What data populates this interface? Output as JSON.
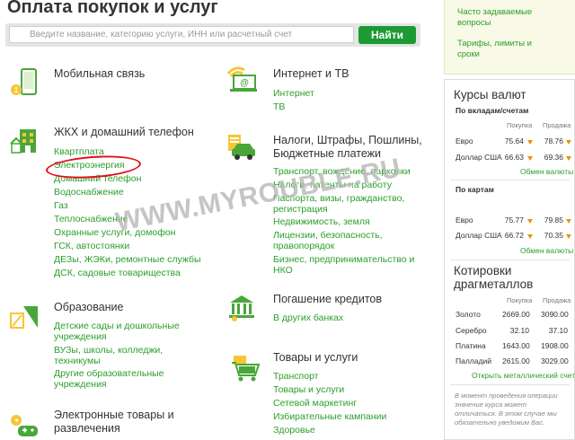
{
  "page": {
    "title": "Оплата покупок и услуг"
  },
  "search": {
    "placeholder": "Введите название, категорию услуги, ИНН или расчетный счет",
    "button_label": "Найти"
  },
  "categories": {
    "mobile": {
      "title": "Мобильная связь"
    },
    "internet": {
      "title": "Интернет и ТВ",
      "links": [
        "Интернет",
        "ТВ"
      ]
    },
    "zhkh": {
      "title": "ЖКХ и домашний телефон",
      "links": [
        "Квартплата",
        "Электроэнергия",
        "Домашний телефон",
        "Водоснабжение",
        "Газ",
        "Теплоснабжение",
        "Охранные услуги, домофон",
        "ГСК, автостоянки",
        "ДЕЗы, ЖЭКи, ремонтные службы",
        "ДСК, садовые товарищества"
      ]
    },
    "taxes": {
      "title_line1": "Налоги, Штрафы, Пошлины,",
      "title_line2": "Бюджетные платежи",
      "links": [
        "Транспорт, вождение, парковки",
        "Налоги, патенты на работу",
        "Паспорта, визы, гражданство,",
        "регистрация",
        "Недвижимость, земля",
        "Лицензии, безопасность,",
        "правопорядок",
        "Бизнес, предпринимательство и",
        "НКО"
      ]
    },
    "education": {
      "title": "Образование",
      "links": [
        "Детские сады и дошкольные",
        "учреждения",
        "ВУЗы, школы, колледжи,",
        "техникумы",
        "Другие образовательные",
        "учреждения"
      ]
    },
    "loans": {
      "title": "Погашение кредитов",
      "links": [
        "В других банках"
      ]
    },
    "goods": {
      "title": "Товары и услуги",
      "links": [
        "Транспорт",
        "Товары и услуги",
        "Сетевой маркетинг",
        "Избирательные кампании",
        "Здоровье"
      ]
    },
    "electronic": {
      "title_line1": "Электронные товары и",
      "title_line2": "развлечения"
    }
  },
  "sidebar": {
    "faq_line1": "Часто задаваемые",
    "faq_line2": "вопросы",
    "tariffs_line1": "Тарифы, лимиты и",
    "tariffs_line2": "сроки"
  },
  "rates": {
    "title": "Курсы валют",
    "deposits": {
      "subtitle": "По вкладам/счетам",
      "buy_label": "Покупка",
      "sell_label": "Продажа",
      "rows": [
        {
          "currency": "Евро",
          "buy": "75.64",
          "sell": "78.76"
        },
        {
          "currency": "Доллар США",
          "buy": "66.63",
          "sell": "69.36"
        }
      ],
      "exchange_link": "Обмен валюты"
    },
    "cards": {
      "subtitle": "По картам",
      "rows": [
        {
          "currency": "Евро",
          "buy": "75.77",
          "sell": "79.85"
        },
        {
          "currency": "Доллар США",
          "buy": "66.72",
          "sell": "70.35"
        }
      ],
      "exchange_link": "Обмен валюты"
    }
  },
  "metals": {
    "title_line1": "Котировки",
    "title_line2": "драгметаллов",
    "buy_label": "Покупка",
    "sell_label": "Продажа",
    "rows": [
      {
        "metal": "Золото",
        "buy": "2669.00",
        "sell": "3090.00"
      },
      {
        "metal": "Серебро",
        "buy": "32.10",
        "sell": "37.10"
      },
      {
        "metal": "Платина",
        "buy": "1643.00",
        "sell": "1908.00"
      },
      {
        "metal": "Палладий",
        "buy": "2615.00",
        "sell": "3029.00"
      }
    ],
    "account_link": "Открыть металлический счет"
  },
  "note": {
    "line1": "В момент проведения операции",
    "line2": "значение курса может",
    "line3": "отличаться. В этом случае мы",
    "line4": "обязательно уведомим Вас."
  },
  "watermark": "WWW.MYROUBLE.RU",
  "colors": {
    "accent_green": "#2b9e2b",
    "button_green": "#1d9a33",
    "arrow_orange": "#e8930c",
    "annotation_red": "#e0101a"
  },
  "icons": [
    "search-icon",
    "mobile-phone-icon",
    "internet-tv-icon",
    "house-icon",
    "car-tax-icon",
    "education-icon",
    "bank-icon",
    "shopping-cart-icon",
    "gamepad-icon",
    "arrow-down-icon"
  ]
}
